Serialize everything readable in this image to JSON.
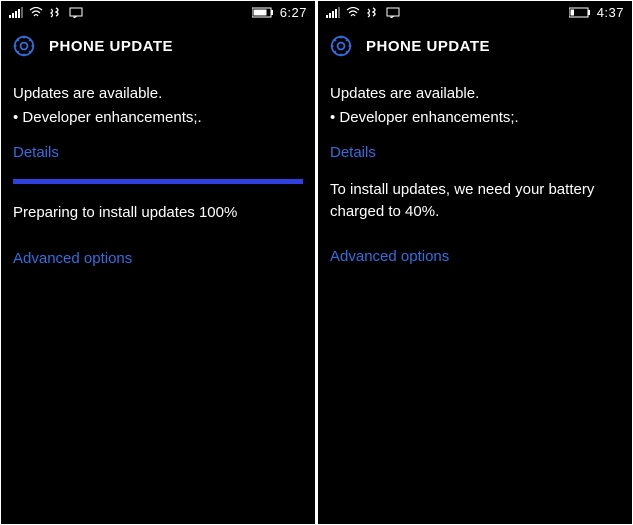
{
  "left": {
    "clock": "6:27",
    "title": "PHONE UPDATE",
    "available": "Updates are available.",
    "item": "• Developer enhancements;.",
    "details": "Details",
    "status": "Preparing to install updates 100%",
    "advanced": "Advanced options"
  },
  "right": {
    "clock": "4:37",
    "title": "PHONE UPDATE",
    "available": "Updates are available.",
    "item": "• Developer enhancements;.",
    "details": "Details",
    "body": "To install updates, we need your battery charged to 40%.",
    "advanced": "Advanced options"
  }
}
